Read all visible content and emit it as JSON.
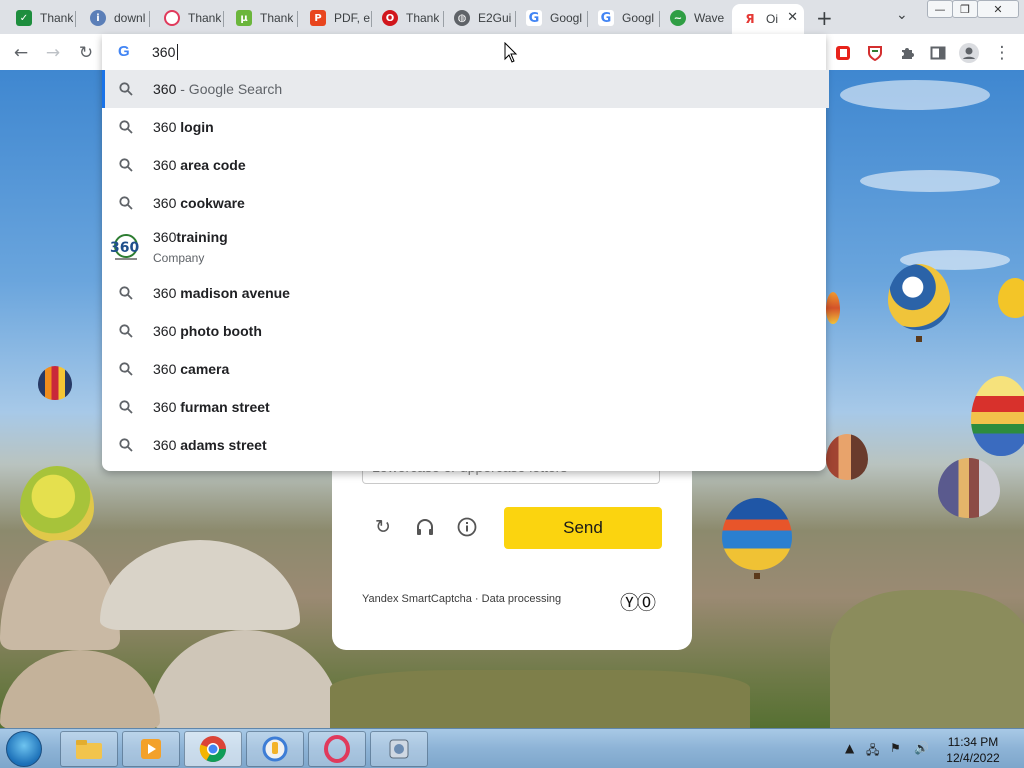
{
  "tabs": [
    {
      "title": "Thank",
      "icon": "green-sheet-icon",
      "color": "#1e8e3e"
    },
    {
      "title": "downl",
      "icon": "info-icon",
      "color": "#5b7fb8"
    },
    {
      "title": "Thank",
      "icon": "opera-icon",
      "color": "#e03a5c"
    },
    {
      "title": "Thank",
      "icon": "utorrent-icon",
      "color": "#6bb63c"
    },
    {
      "title": "PDF, e",
      "icon": "pdf-icon",
      "color": "#e8451e"
    },
    {
      "title": "Thank",
      "icon": "opera-red-icon",
      "color": "#d1161c"
    },
    {
      "title": "E2Gui",
      "icon": "globe-icon",
      "color": "#5f6368"
    },
    {
      "title": "Googl",
      "icon": "google-icon",
      "color": "#4285f4"
    },
    {
      "title": "Googl",
      "icon": "google-icon",
      "color": "#4285f4"
    },
    {
      "title": "Wave",
      "icon": "wave-icon",
      "color": "#2f9e44"
    },
    {
      "title": "Oi",
      "icon": "yandex-icon",
      "color": "#e53935"
    }
  ],
  "window_controls": {
    "minimize": "—",
    "restore": "❐",
    "close": "✕"
  },
  "omnibox": {
    "text": "360",
    "engine_icon": "G"
  },
  "suggestions": [
    {
      "prefix": "360",
      "bold": "",
      "suffix": " - Google Search"
    },
    {
      "prefix": "360 ",
      "bold": "login",
      "suffix": ""
    },
    {
      "prefix": "360 ",
      "bold": "area code",
      "suffix": ""
    },
    {
      "prefix": "360 ",
      "bold": "cookware",
      "suffix": ""
    },
    {
      "prefix": "360 ",
      "bold": "madison avenue",
      "suffix": ""
    },
    {
      "prefix": "360 ",
      "bold": "photo booth",
      "suffix": ""
    },
    {
      "prefix": "360 ",
      "bold": "camera",
      "suffix": ""
    },
    {
      "prefix": "360 ",
      "bold": "furman street",
      "suffix": ""
    },
    {
      "prefix": "360 ",
      "bold": "adams street",
      "suffix": ""
    }
  ],
  "entity": {
    "prefix": "360",
    "bold": "training",
    "subtitle": "Company"
  },
  "captcha": {
    "placeholder": "Lowercase or uppercase letters",
    "send_label": "Send",
    "footer_brand": "Yandex SmartCaptcha",
    "footer_sep": " · ",
    "footer_link": "Data processing"
  },
  "clock": {
    "time": "11:34 PM",
    "date": "12/4/2022"
  }
}
